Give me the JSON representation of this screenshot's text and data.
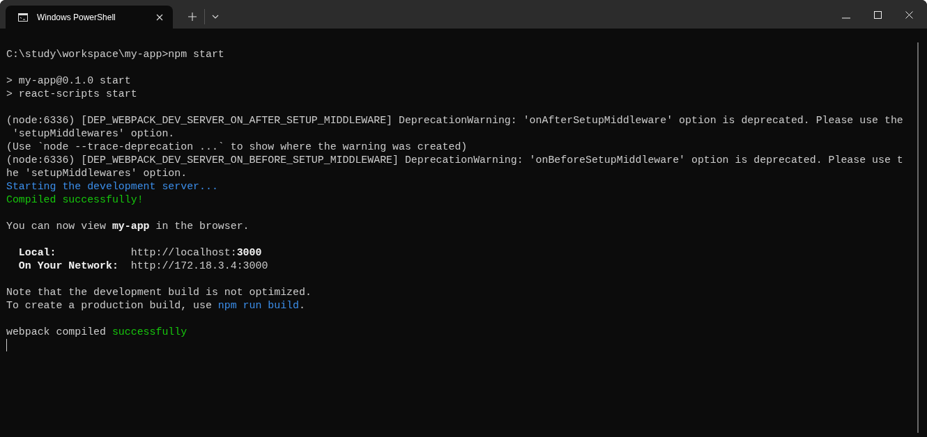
{
  "tabs": [
    {
      "title": "Windows PowerShell",
      "selected": true
    }
  ],
  "terminal": {
    "blocks": [
      [
        {
          "segments": [
            {
              "text": "C:\\study\\workspace\\my-app>npm start",
              "kind": "plain"
            }
          ]
        }
      ],
      [
        {
          "segments": [
            {
              "text": "> my-app@0.1.0 start",
              "kind": "plain"
            }
          ]
        },
        {
          "segments": [
            {
              "text": "> react-scripts start",
              "kind": "plain"
            }
          ]
        }
      ],
      [
        {
          "segments": [
            {
              "text": "(node:6336) [DEP_WEBPACK_DEV_SERVER_ON_AFTER_SETUP_MIDDLEWARE] DeprecationWarning: 'onAfterSetupMiddleware' option is deprecated. Please use the",
              "kind": "plain"
            }
          ]
        },
        {
          "segments": [
            {
              "text": " 'setupMiddlewares' option.",
              "kind": "plain"
            }
          ]
        },
        {
          "segments": [
            {
              "text": "(Use `node --trace-deprecation ...` to show where the warning was created)",
              "kind": "plain"
            }
          ]
        },
        {
          "segments": [
            {
              "text": "(node:6336) [DEP_WEBPACK_DEV_SERVER_ON_BEFORE_SETUP_MIDDLEWARE] DeprecationWarning: 'onBeforeSetupMiddleware' option is deprecated. Please use t",
              "kind": "plain"
            }
          ]
        },
        {
          "segments": [
            {
              "text": "he 'setupMiddlewares' option.",
              "kind": "plain"
            }
          ]
        },
        {
          "segments": [
            {
              "text": "Starting the development server...",
              "kind": "blue"
            }
          ]
        },
        {
          "segments": [
            {
              "text": "Compiled successfully!",
              "kind": "green"
            }
          ]
        }
      ],
      [
        {
          "segments": [
            {
              "text": "You can now view ",
              "kind": "plain"
            },
            {
              "text": "my-app",
              "kind": "bold"
            },
            {
              "text": " in the browser.",
              "kind": "plain"
            }
          ]
        }
      ],
      [
        {
          "segments": [
            {
              "text": "  Local:",
              "kind": "bold"
            },
            {
              "text": "            http://localhost:",
              "kind": "plain"
            },
            {
              "text": "3000",
              "kind": "bold"
            }
          ]
        },
        {
          "segments": [
            {
              "text": "  On Your Network:",
              "kind": "bold"
            },
            {
              "text": "  http://172.18.3.4:3000",
              "kind": "plain"
            }
          ]
        }
      ],
      [
        {
          "segments": [
            {
              "text": "Note that the development build is not optimized.",
              "kind": "plain"
            }
          ]
        },
        {
          "segments": [
            {
              "text": "To create a production build, use ",
              "kind": "plain"
            },
            {
              "text": "npm run build",
              "kind": "blue"
            },
            {
              "text": ".",
              "kind": "plain"
            }
          ]
        }
      ],
      [
        {
          "segments": [
            {
              "text": "webpack compiled ",
              "kind": "plain"
            },
            {
              "text": "successfully",
              "kind": "green"
            }
          ]
        }
      ]
    ]
  }
}
